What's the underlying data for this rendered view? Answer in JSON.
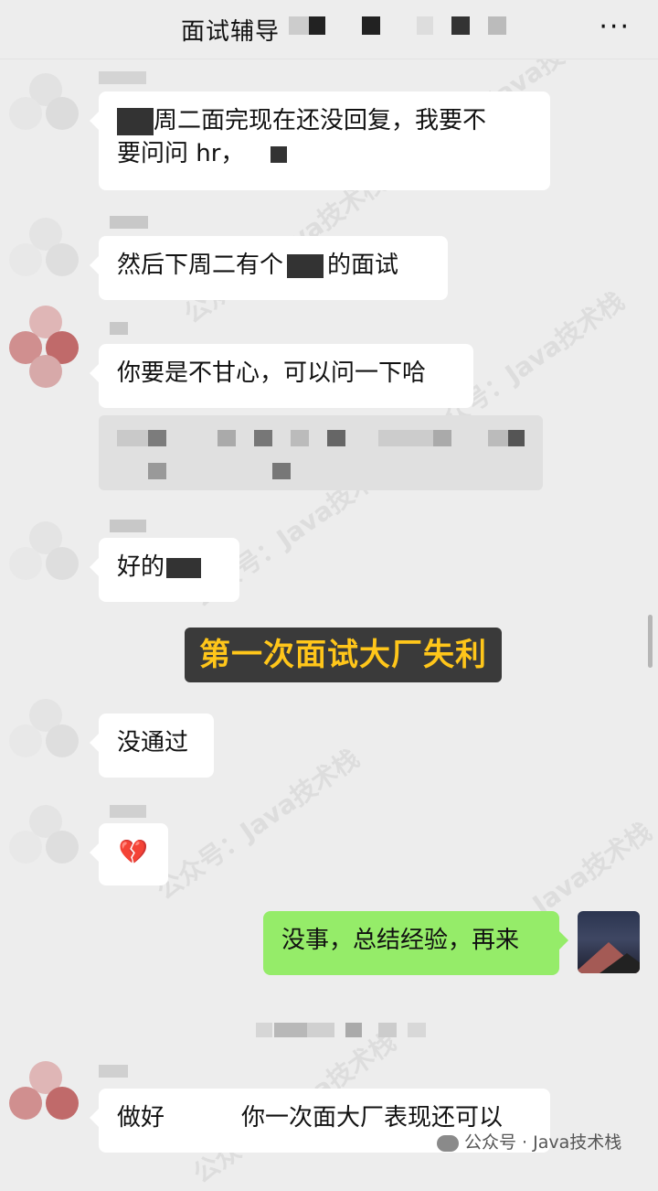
{
  "header": {
    "title": "面试辅导",
    "more_label": "···"
  },
  "messages": [
    {
      "id": "m1",
      "from": "other",
      "text_a": "周二面完现在还没回复，我要不",
      "text_b": "要问问 hr，"
    },
    {
      "id": "m2",
      "from": "other",
      "text_a": "然后下周二有个",
      "text_b": "的面试"
    },
    {
      "id": "m3",
      "from": "other",
      "text": "你要是不甘心，可以问一下哈"
    },
    {
      "id": "m4",
      "from": "other",
      "text": "好的"
    },
    {
      "id": "m5",
      "from": "other",
      "text": "没通过"
    },
    {
      "id": "m6",
      "from": "other",
      "icon": "broken-heart-icon",
      "text": "💔"
    },
    {
      "id": "m7",
      "from": "me",
      "text": "没事，总结经验，再来"
    },
    {
      "id": "m8",
      "from": "other",
      "text_a": "做好",
      "text_b": "你一次面大厂表现还可以"
    }
  ],
  "caption": {
    "text": "第一次面试大厂失利"
  },
  "watermark": {
    "text": "公众号 · Java技术栈",
    "icon": "wechat-official-icon"
  },
  "background_watermark": "公众号：Java技术栈",
  "colors": {
    "bg": "#ededed",
    "bubble_other": "#ffffff",
    "bubble_me": "#95ec69",
    "caption_text": "#ffc61a",
    "caption_bg": "#3a3a3a"
  }
}
